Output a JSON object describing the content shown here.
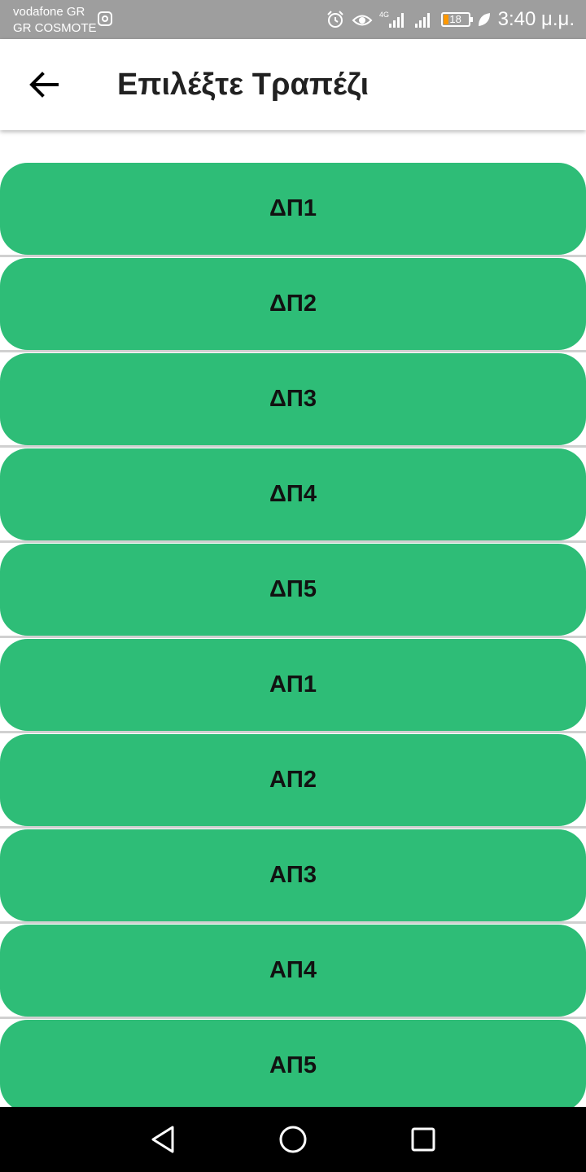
{
  "status_bar": {
    "carrier_line1": "vodafone GR",
    "carrier_line2": "GR COSMOTE",
    "network_type": "4G",
    "battery_level": "18",
    "time": "3:40 μ.μ.",
    "icons": [
      "instagram-icon",
      "alarm-icon",
      "eye-comfort-icon",
      "signal-icon",
      "battery-icon",
      "leaf-icon"
    ]
  },
  "app_bar": {
    "title": "Επιλέξτε Τραπέζι",
    "back_icon": "arrow-left-icon"
  },
  "tables": [
    {
      "label": "ΔΠ1"
    },
    {
      "label": "ΔΠ2"
    },
    {
      "label": "ΔΠ3"
    },
    {
      "label": "ΔΠ4"
    },
    {
      "label": "ΔΠ5"
    },
    {
      "label": "ΑΠ1"
    },
    {
      "label": "ΑΠ2"
    },
    {
      "label": "ΑΠ3"
    },
    {
      "label": "ΑΠ4"
    },
    {
      "label": "ΑΠ5"
    }
  ],
  "colors": {
    "button_green": "#2ebd77",
    "status_bar": "#9e9e9e",
    "nav_bar": "#000000"
  }
}
